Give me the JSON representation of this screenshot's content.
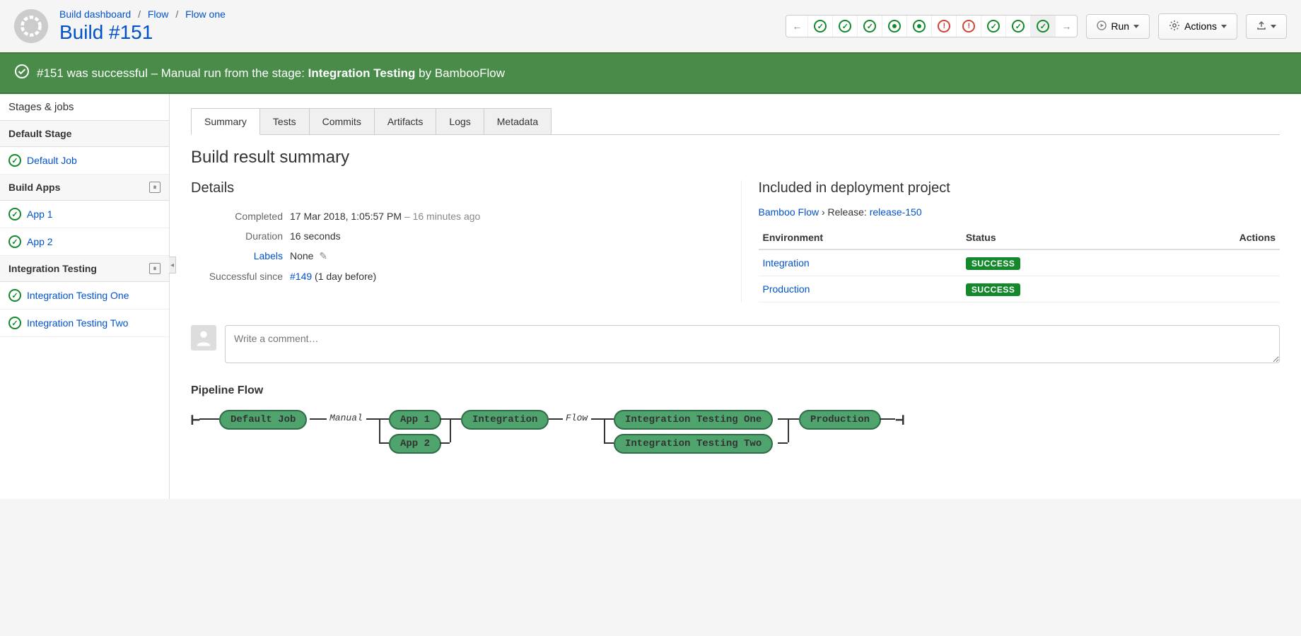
{
  "breadcrumb": {
    "items": [
      "Build dashboard",
      "Flow",
      "Flow one"
    ]
  },
  "page_title": "Build #151",
  "toolbar": {
    "run_label": "Run",
    "actions_label": "Actions"
  },
  "build_history": [
    {
      "status": "back-arrow"
    },
    {
      "status": "success"
    },
    {
      "status": "success"
    },
    {
      "status": "success"
    },
    {
      "status": "success-dot"
    },
    {
      "status": "success-dot"
    },
    {
      "status": "failed"
    },
    {
      "status": "failed"
    },
    {
      "status": "success"
    },
    {
      "status": "success"
    },
    {
      "status": "success",
      "selected": true
    },
    {
      "status": "forward-arrow"
    }
  ],
  "status_banner": {
    "prefix": "#151 was successful",
    "middle": " – Manual run from the stage: ",
    "stage": "Integration Testing",
    "suffix": " by BambooFlow"
  },
  "sidebar": {
    "heading": "Stages & jobs",
    "stages": [
      {
        "name": "Default Stage",
        "icon": null,
        "jobs": [
          {
            "name": "Default Job",
            "status": "success"
          }
        ]
      },
      {
        "name": "Build Apps",
        "icon": "pause",
        "jobs": [
          {
            "name": "App 1",
            "status": "success"
          },
          {
            "name": "App 2",
            "status": "success"
          }
        ]
      },
      {
        "name": "Integration Testing",
        "icon": "pause",
        "jobs": [
          {
            "name": "Integration Testing One",
            "status": "success"
          },
          {
            "name": "Integration Testing Two",
            "status": "success"
          }
        ]
      }
    ]
  },
  "tabs": [
    "Summary",
    "Tests",
    "Commits",
    "Artifacts",
    "Logs",
    "Metadata"
  ],
  "active_tab": 0,
  "section_title": "Build result summary",
  "details": {
    "heading": "Details",
    "rows": {
      "completed_label": "Completed",
      "completed_value": "17 Mar 2018, 1:05:57 PM",
      "completed_ago": " – 16 minutes ago",
      "duration_label": "Duration",
      "duration_value": "16 seconds",
      "labels_label": "Labels",
      "labels_value": "None",
      "since_label": "Successful since",
      "since_link": "#149",
      "since_suffix": " (1 day before)"
    }
  },
  "deployment": {
    "heading": "Included in deployment project",
    "project_link": "Bamboo Flow",
    "release_prefix": " › Release: ",
    "release_link": "release-150",
    "columns": {
      "env": "Environment",
      "status": "Status",
      "actions": "Actions"
    },
    "rows": [
      {
        "env": "Integration",
        "status": "SUCCESS"
      },
      {
        "env": "Production",
        "status": "SUCCESS"
      }
    ]
  },
  "comment": {
    "placeholder": "Write a comment…"
  },
  "pipeline": {
    "heading": "Pipeline Flow",
    "nodes": {
      "default_job": "Default Job",
      "manual": "Manual",
      "app1": "App 1",
      "app2": "App 2",
      "integration": "Integration",
      "flow": "Flow",
      "it_one": "Integration Testing One",
      "it_two": "Integration Testing Two",
      "production": "Production"
    }
  }
}
